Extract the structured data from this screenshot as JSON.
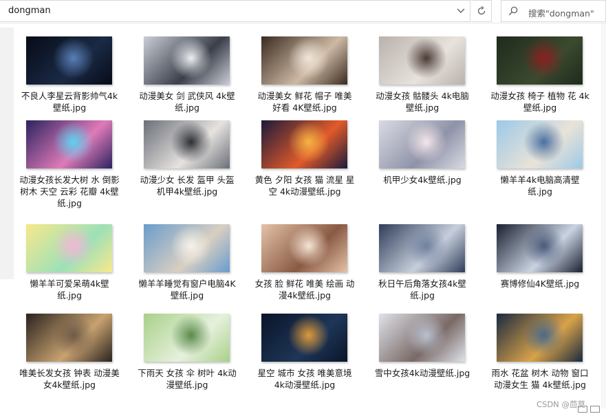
{
  "address_bar": {
    "path": "dongman"
  },
  "search": {
    "placeholder": "搜索\"dongman\""
  },
  "files": [
    {
      "name": "不良人李星云背影帅气4k壁纸.jpg",
      "colors": [
        "#070b17",
        "#1a2a45",
        "#5a7fb8"
      ]
    },
    {
      "name": "动漫美女 剑 武侠风 4k壁纸.jpg",
      "colors": [
        "#c9ced6",
        "#3b3f4a",
        "#eceff3"
      ]
    },
    {
      "name": "动漫美女 鲜花 帽子 唯美好看 4K壁纸.jpg",
      "colors": [
        "#3a2a20",
        "#cdb9a4",
        "#f1e6da"
      ]
    },
    {
      "name": "动漫女孩 骷髅头 4k电脑壁纸.jpg",
      "colors": [
        "#b9b2ac",
        "#e8e2dc",
        "#4a3a36"
      ]
    },
    {
      "name": "动漫女孩 椅子 植物 花 4k壁纸.jpg",
      "colors": [
        "#1f2a1c",
        "#3b4a2f",
        "#8a2020"
      ]
    },
    {
      "name": "动漫女孩长发大树 水 倒影 树木 天空 云彩 花瓣 4k壁纸.jpg",
      "colors": [
        "#2a2360",
        "#e07ab8",
        "#5bd2f0"
      ]
    },
    {
      "name": "动漫少女 长发 盔甲 头盔 机甲4k壁纸.jpg",
      "colors": [
        "#6a6f78",
        "#e6e2df",
        "#2c2f36"
      ]
    },
    {
      "name": "黄色 夕阳 女孩 猫 流星 星空 4k动漫壁纸.jpg",
      "colors": [
        "#1b1a3a",
        "#e25a2a",
        "#f7b444"
      ]
    },
    {
      "name": "机甲少女4k壁纸.jpg",
      "colors": [
        "#d9dbe3",
        "#8f93a8",
        "#f4e6ea"
      ]
    },
    {
      "name": "懒羊羊4k电脑高清壁纸.jpg",
      "colors": [
        "#9cc9e8",
        "#e9e3d8",
        "#4a6fa0"
      ]
    },
    {
      "name": "懒羊羊可爱呆萌4k壁纸.jpg",
      "colors": [
        "#f7e98a",
        "#9ee0b8",
        "#f4b6d6"
      ]
    },
    {
      "name": "懒羊羊睡觉有窗户电脑4K壁纸.jpg",
      "colors": [
        "#6a9ccc",
        "#d9cfc1",
        "#f5f2ea"
      ]
    },
    {
      "name": "女孩 脸 鲜花 唯美 绘画 动漫4k壁纸.jpg",
      "colors": [
        "#e4c2a8",
        "#8a5a44",
        "#f6e4d4"
      ]
    },
    {
      "name": "秋日午后角落女孩4k壁纸.jpg",
      "colors": [
        "#2f3d5a",
        "#c7cfdc",
        "#70819e"
      ]
    },
    {
      "name": "赛博修仙4K壁纸.jpg",
      "colors": [
        "#1a2030",
        "#c9d3e2",
        "#4a5a78"
      ]
    },
    {
      "name": "唯美长发女孩 钟表 动漫美女4k壁纸.jpg",
      "colors": [
        "#2a2320",
        "#c8a270",
        "#6f5a48"
      ]
    },
    {
      "name": "下雨天 女孩 伞 树叶 4k动漫壁纸.jpg",
      "colors": [
        "#a8d08a",
        "#e6f1dc",
        "#5a8a4a"
      ]
    },
    {
      "name": "星空 城市 女孩 唯美意境4k动漫壁纸.jpg",
      "colors": [
        "#0a1428",
        "#1e3658",
        "#dd9a3a"
      ]
    },
    {
      "name": "雪中女孩4k动漫壁纸.jpg",
      "colors": [
        "#dfe2ea",
        "#7a6a66",
        "#b9c0cf"
      ]
    },
    {
      "name": "雨水 花盆 树木 动物 窗口 动漫女生 猫 4k壁纸.jpg",
      "colors": [
        "#1a2a3f",
        "#d9a24a",
        "#4a6a8a"
      ]
    }
  ],
  "watermark": "CSDN @茴莫"
}
